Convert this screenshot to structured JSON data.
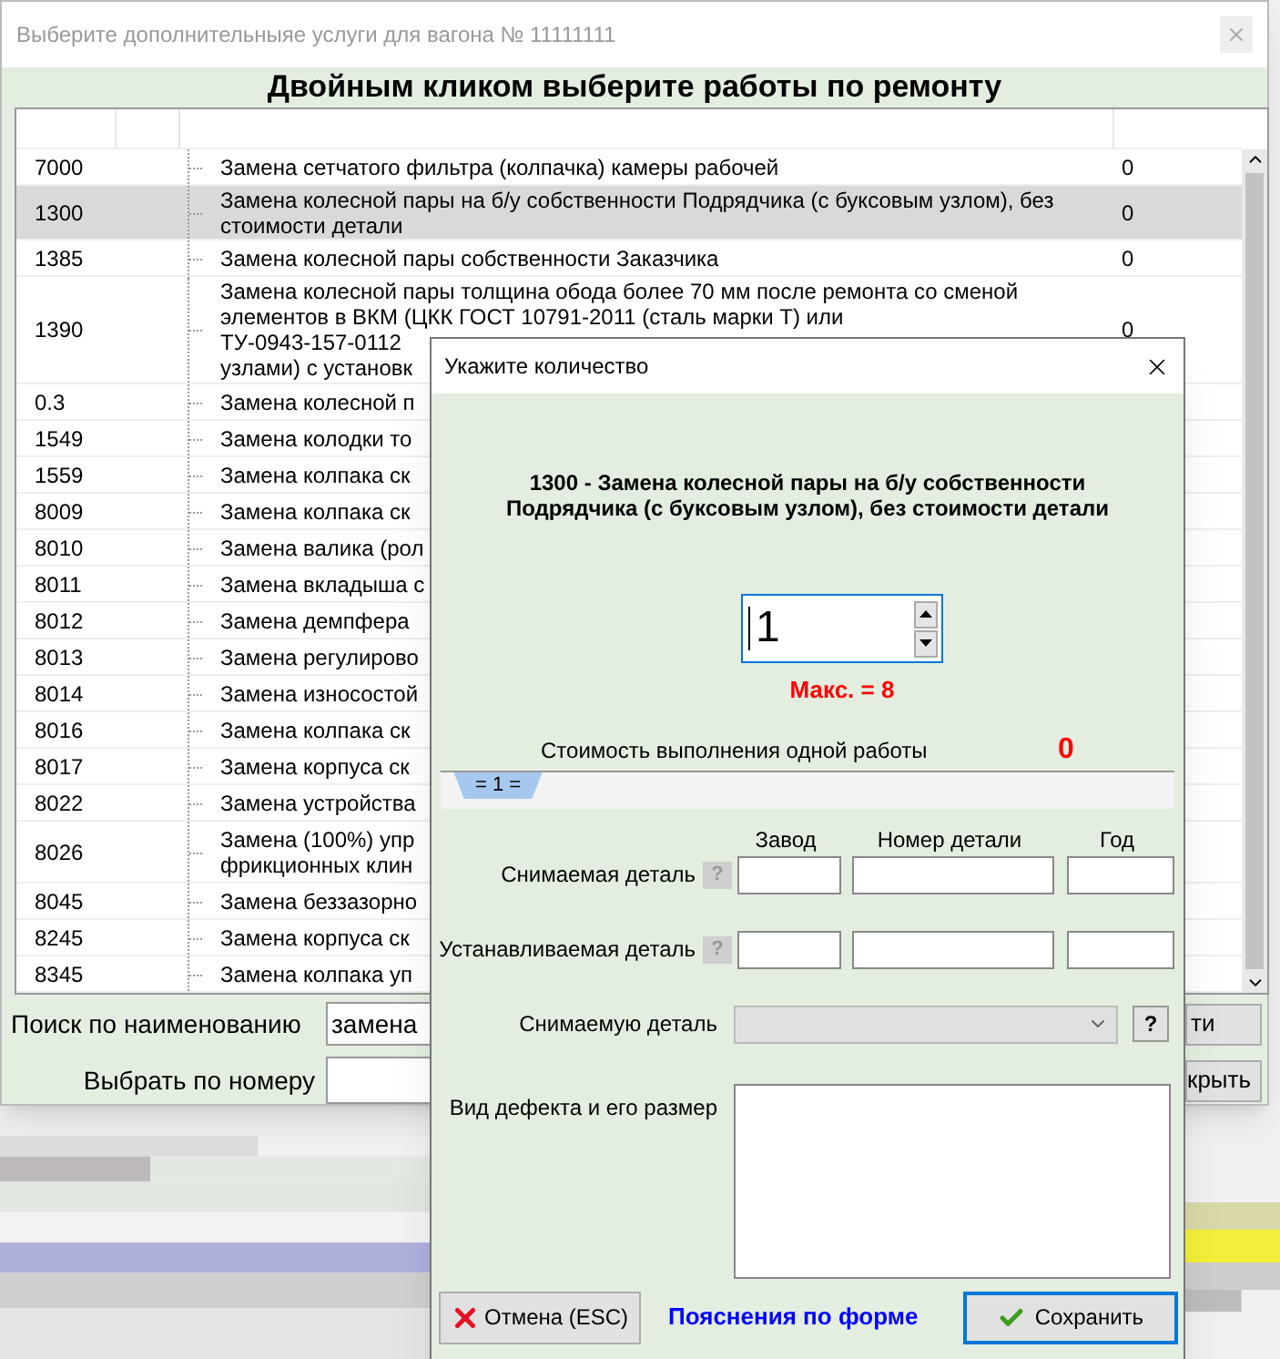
{
  "window": {
    "title": "Выберите дополнительныяе услуги для вагона № 11111111",
    "heading": "Двойным кликом выберите работы по ремонту"
  },
  "table": {
    "rows": [
      {
        "code": "7000",
        "lines": [
          "Замена сетчатого фильтра (колпачка) камеры рабочей"
        ],
        "value": "0",
        "selected": false
      },
      {
        "code": "1300",
        "lines": [
          "Замена колесной пары на б/у собственности Подрядчика (с буксовым узлом), без",
          "стоимости детали"
        ],
        "value": "0",
        "selected": true
      },
      {
        "code": "1385",
        "lines": [
          "Замена колесной пары собственности Заказчика"
        ],
        "value": "0",
        "selected": false
      },
      {
        "code": "1390",
        "lines": [
          "Замена колесной пары толщина обода более 70 мм после ремонта со сменой",
          "элементов в ВКМ (ЦКК ГОСТ 10791-2011 (сталь марки Т) или",
          "ТУ-0943-157-0112",
          "узлами) с установк"
        ],
        "value": "0",
        "selected": false
      },
      {
        "code": "0.3",
        "lines": [
          "Замена колесной п"
        ],
        "selected": false
      },
      {
        "code": "1549",
        "lines": [
          "Замена колодки то"
        ],
        "selected": false
      },
      {
        "code": "1559",
        "lines": [
          "Замена колпака ск"
        ],
        "selected": false
      },
      {
        "code": "8009",
        "lines": [
          "Замена колпака ск"
        ],
        "selected": false
      },
      {
        "code": "8010",
        "lines": [
          "Замена валика (рол"
        ],
        "selected": false
      },
      {
        "code": "8011",
        "lines": [
          "Замена вкладыша с"
        ],
        "selected": false
      },
      {
        "code": "8012",
        "lines": [
          "Замена демпфера"
        ],
        "selected": false
      },
      {
        "code": "8013",
        "lines": [
          "Замена регулирово"
        ],
        "selected": false
      },
      {
        "code": "8014",
        "lines": [
          "Замена износостой"
        ],
        "selected": false
      },
      {
        "code": "8016",
        "lines": [
          "Замена колпака ск"
        ],
        "selected": false
      },
      {
        "code": "8017",
        "lines": [
          "Замена корпуса ск"
        ],
        "selected": false
      },
      {
        "code": "8022",
        "lines": [
          "Замена устройства"
        ],
        "selected": false
      },
      {
        "code": "8026",
        "lines": [
          "Замена (100%) упр",
          "фрикционных клин"
        ],
        "selected": false
      },
      {
        "code": "8045",
        "lines": [
          "Замена беззазорно"
        ],
        "selected": false
      },
      {
        "code": "8245",
        "lines": [
          "Замена корпуса ск"
        ],
        "selected": false
      },
      {
        "code": "8345",
        "lines": [
          "Замена колпака уп"
        ],
        "selected": false
      }
    ]
  },
  "search": {
    "name_label": "Поиск по наименованию",
    "name_value": "замена",
    "number_label": "Выбрать по номеру",
    "find_button": "ти",
    "close_button": "крыть"
  },
  "dialog": {
    "title": "Укажите количество",
    "work": "1300 - Замена колесной пары на б/у собственности Подрядчика (с буксовым узлом), без стоимости детали",
    "quantity": "1",
    "max": "Макс. = 8",
    "cost_label": "Стоимость выполнения одной работы",
    "cost": "0",
    "tabs": [
      {
        "label": "= 1 =",
        "selected": true
      }
    ],
    "columns": [
      "Завод",
      "Номер детали",
      "Год"
    ],
    "parts": [
      {
        "label": "Снимаемая деталь",
        "help": "?",
        "disabled": true
      },
      {
        "label": "Устанавливаемая деталь",
        "help": "?",
        "disabled": true
      }
    ],
    "removed_select": {
      "label": "Снимаемую деталь",
      "help": "?",
      "disabled": true
    },
    "defect": {
      "label": "Вид дефекта и его размер"
    },
    "cancel": "Отмена (ESC)",
    "help_link": "Пояснения по форме",
    "save": "Сохранить"
  }
}
